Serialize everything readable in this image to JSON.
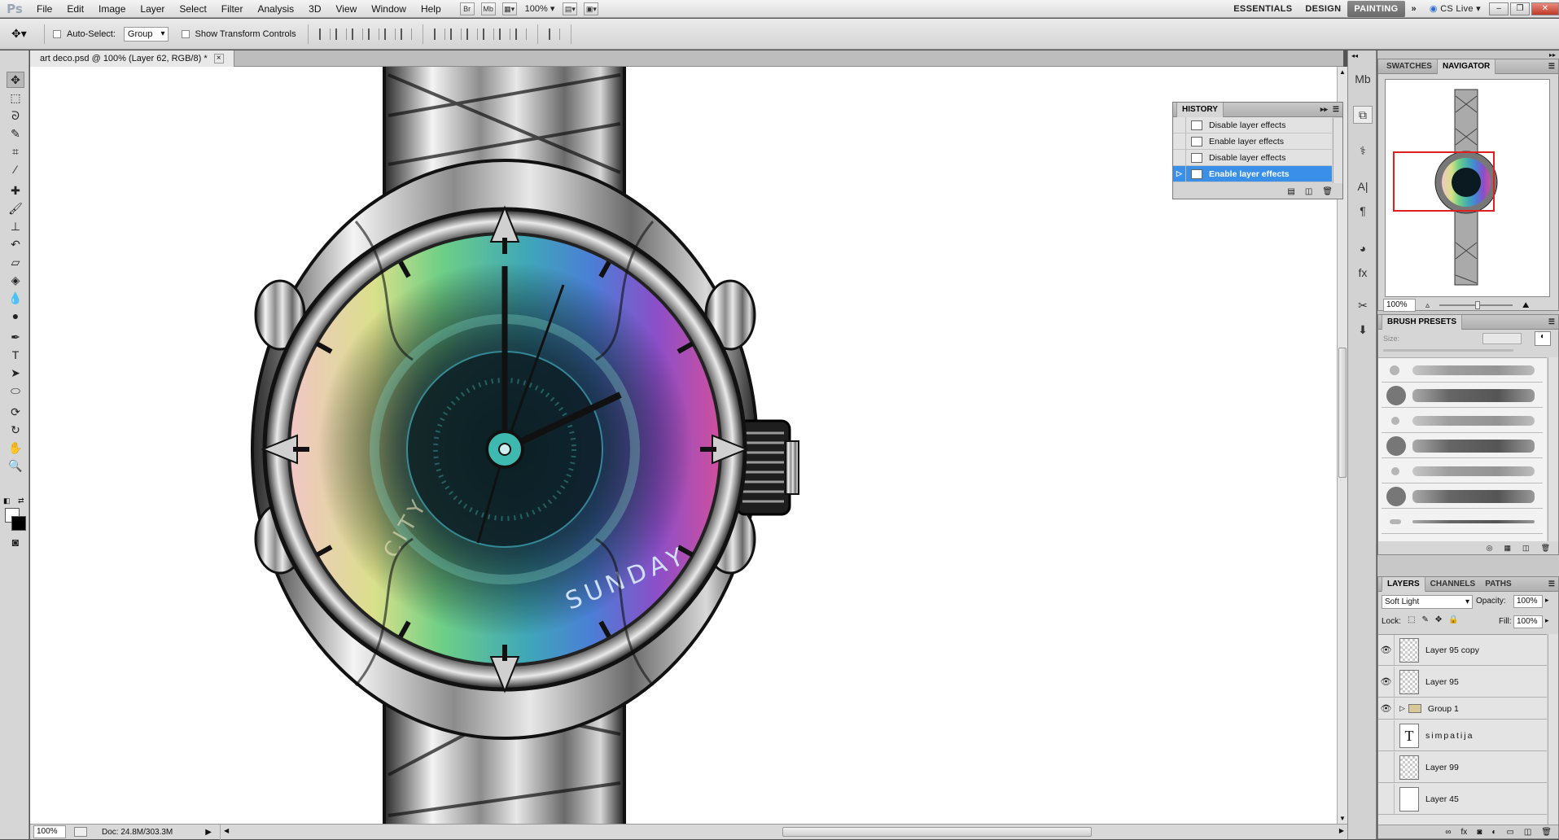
{
  "menubar": {
    "logo": "Ps",
    "items": [
      "File",
      "Edit",
      "Image",
      "Layer",
      "Select",
      "Filter",
      "Analysis",
      "3D",
      "View",
      "Window",
      "Help"
    ],
    "bridge_label": "Br",
    "minibridge_label": "Mb",
    "zoom": "100%",
    "workspaces": [
      "ESSENTIALS",
      "DESIGN",
      "PAINTING"
    ],
    "active_workspace": "PAINTING",
    "cs_live": "CS Live"
  },
  "options": {
    "auto_select_label": "Auto-Select:",
    "auto_select_value": "Group",
    "show_transform_label": "Show Transform Controls"
  },
  "document": {
    "tab_title": "art deco.psd @ 100% (Layer 62, RGB/8) *",
    "dial_word": "SUNDAY",
    "dial_word2": "CITY"
  },
  "status": {
    "zoom": "100%",
    "doc_size": "Doc: 24.8M/303.3M"
  },
  "history": {
    "title": "HISTORY",
    "items": [
      "Disable layer effects",
      "Enable layer effects",
      "Disable layer effects",
      "Enable layer effects"
    ],
    "selected_index": 3
  },
  "navigator": {
    "tabs": [
      "SWATCHES",
      "NAVIGATOR"
    ],
    "active_tab": "NAVIGATOR",
    "zoom": "100%"
  },
  "brush_presets": {
    "title": "BRUSH PRESETS",
    "size_label": "Size:"
  },
  "layers": {
    "tabs": [
      "LAYERS",
      "CHANNELS",
      "PATHS"
    ],
    "active_tab": "LAYERS",
    "blend_mode": "Soft Light",
    "opacity_label": "Opacity:",
    "opacity": "100%",
    "lock_label": "Lock:",
    "fill_label": "Fill:",
    "fill": "100%",
    "rows": [
      {
        "name": "Layer 95 copy",
        "visible": true,
        "kind": "pixel"
      },
      {
        "name": "Layer 95",
        "visible": true,
        "kind": "pixel"
      },
      {
        "name": "Group 1",
        "visible": true,
        "kind": "group"
      },
      {
        "name": "simpatija",
        "visible": false,
        "kind": "text"
      },
      {
        "name": "Layer 99",
        "visible": false,
        "kind": "pixel"
      },
      {
        "name": "Layer 45",
        "visible": false,
        "kind": "pixel"
      }
    ]
  }
}
